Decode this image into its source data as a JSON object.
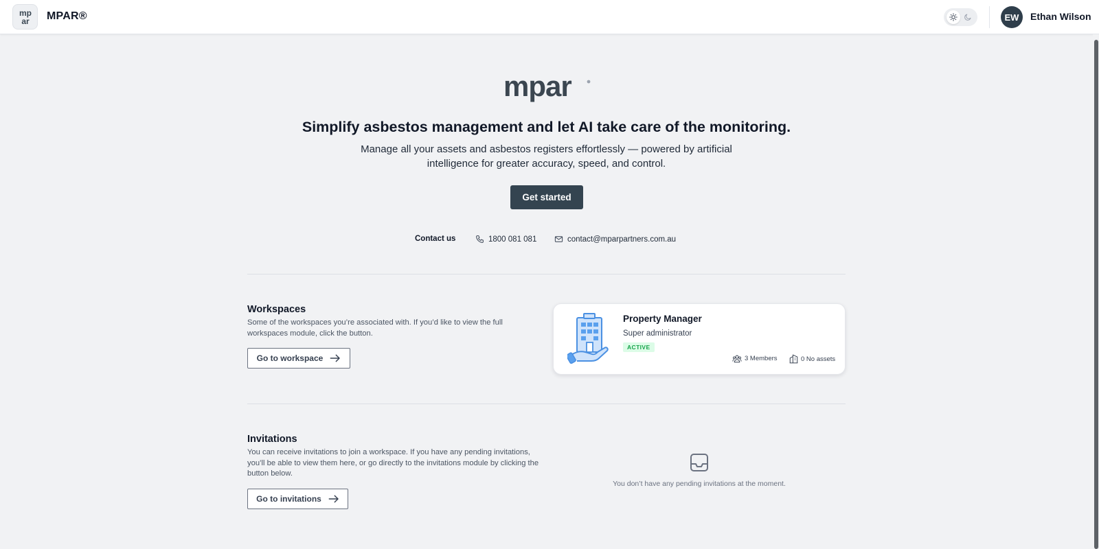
{
  "header": {
    "logo_text": "mp ar",
    "app_name": "MPAR®",
    "theme": {
      "light_icon": "sun-icon",
      "dark_icon": "moon-icon",
      "selected": "light"
    },
    "user": {
      "initials": "EW",
      "name": "Ethan Wilson"
    }
  },
  "hero": {
    "wordmark": "mpar",
    "title": "Simplify asbestos management and let AI take care of the monitoring.",
    "subtitle_line1": "Manage all your assets and asbestos registers effortlessly — powered by artificial",
    "subtitle_line2": "intelligence for greater accuracy, speed, and control.",
    "cta_label": "Get started"
  },
  "contact": {
    "label": "Contact us",
    "phone": "1800 081 081",
    "email": "contact@mparpartners.com.au"
  },
  "workspaces": {
    "title": "Workspaces",
    "description": "Some of the workspaces you’re associated with. If you’d like to view the full workspaces module, click the button.",
    "button_label": "Go to workspace",
    "card": {
      "name": "Property Manager",
      "role": "Super administrator",
      "status": "ACTIVE",
      "members": "3 Members",
      "assets": "0 No assets"
    }
  },
  "invitations": {
    "title": "Invitations",
    "description": "You can receive invitations to join a workspace. If you have any pending invitations, you’ll be able to view them here, or go directly to the invitations module by clicking the button below.",
    "button_label": "Go to invitations",
    "empty_message": "You don’t have any pending invitations at the moment."
  },
  "colors": {
    "brand_dark": "#344450",
    "background": "#f1f2f4",
    "active_badge_bg": "#dcfce7",
    "active_badge_text": "#16a34a",
    "illustration_blue": "#5aa0ee"
  }
}
